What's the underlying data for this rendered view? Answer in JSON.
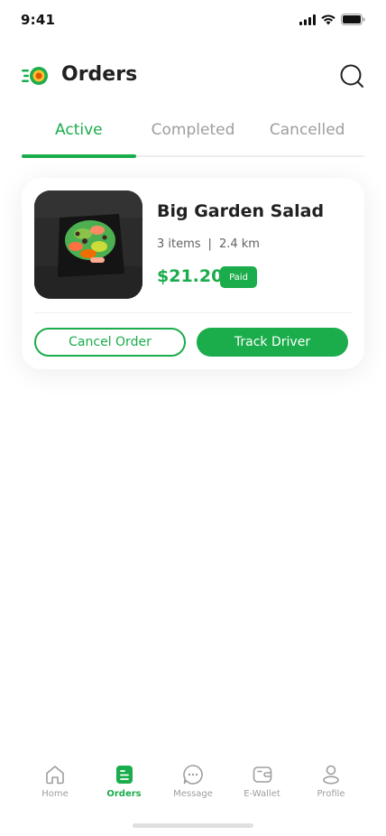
{
  "status_bar": {
    "time": "9:41"
  },
  "header": {
    "title": "Orders"
  },
  "tabs": [
    {
      "label": "Active",
      "active": true
    },
    {
      "label": "Completed",
      "active": false
    },
    {
      "label": "Cancelled",
      "active": false
    }
  ],
  "order": {
    "name": "Big Garden Salad",
    "items": "3 items",
    "separator": "|",
    "distance": "2.4 km",
    "price": "$21.20",
    "payment_status": "Paid",
    "cancel_label": "Cancel Order",
    "track_label": "Track Driver"
  },
  "bottom_nav": {
    "items": [
      {
        "label": "Home",
        "icon": "home-icon",
        "active": false
      },
      {
        "label": "Orders",
        "icon": "orders-icon",
        "active": true
      },
      {
        "label": "Message",
        "icon": "message-icon",
        "active": false
      },
      {
        "label": "E-Wallet",
        "icon": "wallet-icon",
        "active": false
      },
      {
        "label": "Profile",
        "icon": "profile-icon",
        "active": false
      }
    ]
  },
  "colors": {
    "accent": "#1BAC4B",
    "text": "#212121",
    "muted": "#9E9E9E"
  }
}
